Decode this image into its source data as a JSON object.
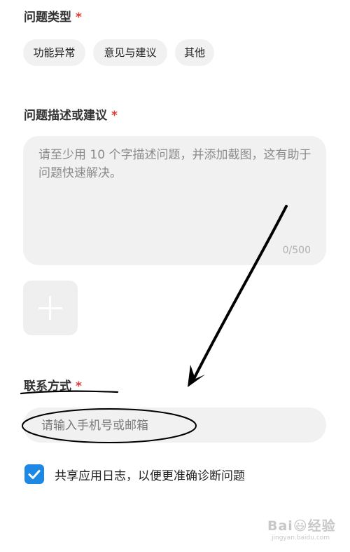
{
  "issue_type": {
    "title": "问题类型",
    "required_mark": "*",
    "options": [
      "功能异常",
      "意见与建议",
      "其他"
    ]
  },
  "description": {
    "title": "问题描述或建议",
    "required_mark": "*",
    "placeholder": "请至少用 10 个字描述问题，并添加截图，这有助于问题快速解决。",
    "counter": "0/500"
  },
  "attachment": {
    "icon": "plus-icon"
  },
  "contact": {
    "title": "联系方式",
    "required_mark": "*",
    "placeholder": "请输入手机号或邮箱"
  },
  "share_log": {
    "label": "共享应用日志，以便更准确诊断问题",
    "checked": true
  },
  "watermark": {
    "main": "Bai😃经验",
    "sub": "jingyan.baidu.com"
  },
  "colors": {
    "required": "#e53935",
    "checkbox": "#1e88e5",
    "field_bg": "#f1f1f1",
    "annotation": "#000000"
  }
}
